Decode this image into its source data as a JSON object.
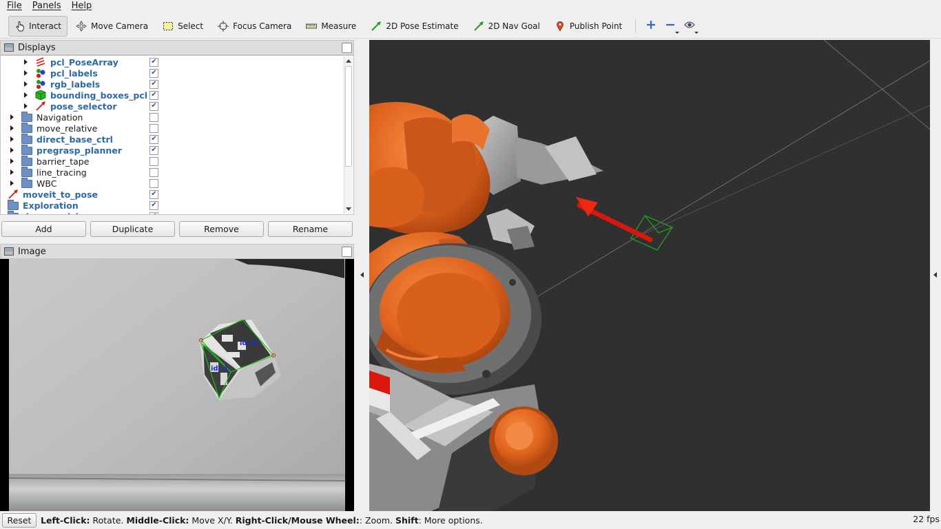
{
  "menubar": {
    "items": [
      {
        "label": "File"
      },
      {
        "label": "Panels"
      },
      {
        "label": "Help"
      }
    ]
  },
  "toolbar": {
    "interact": "Interact",
    "move_camera": "Move Camera",
    "select": "Select",
    "focus_camera": "Focus Camera",
    "measure": "Measure",
    "pose_estimate": "2D Pose Estimate",
    "nav_goal": "2D Nav Goal",
    "publish_point": "Publish Point",
    "add_tool_icon": "plus-icon",
    "remove_tool_icon": "minus-icon",
    "views_icon": "eye-icon"
  },
  "displays": {
    "title": "Displays",
    "rows": [
      {
        "label": "pcl_PoseArray",
        "checked": true
      },
      {
        "label": "pcl_labels",
        "checked": true
      },
      {
        "label": "rgb_labels",
        "checked": true
      },
      {
        "label": "bounding_boxes_pcl",
        "checked": true
      },
      {
        "label": "pose_selector",
        "checked": true
      },
      {
        "label": "Navigation",
        "checked": false
      },
      {
        "label": "move_relative",
        "checked": false
      },
      {
        "label": "direct_base_ctrl",
        "checked": true
      },
      {
        "label": "pregrasp_planner",
        "checked": true
      },
      {
        "label": "barrier_tape",
        "checked": false
      },
      {
        "label": "line_tracing",
        "checked": false
      },
      {
        "label": "WBC",
        "checked": false
      },
      {
        "label": "moveit_to_pose",
        "checked": true
      },
      {
        "label": "Exploration",
        "checked": true
      },
      {
        "label": "drawer_pick",
        "checked": true
      }
    ],
    "buttons": {
      "add": "Add",
      "duplicate": "Duplicate",
      "remove": "Remove",
      "rename": "Rename"
    }
  },
  "image_panel": {
    "title": "Image",
    "marker_labels": [
      "id=0",
      "id=1"
    ]
  },
  "statusbar": {
    "reset": "Reset",
    "hint_1_key": "Left-Click:",
    "hint_1_val": " Rotate. ",
    "hint_2_key": "Middle-Click:",
    "hint_2_val": " Move X/Y. ",
    "hint_3_key": "Right-Click/Mouse Wheel:",
    "hint_3_val": ": Zoom. ",
    "hint_4_key": "Shift",
    "hint_4_val": ": More options.",
    "fps": "22 fps"
  },
  "colors": {
    "robot_orange": "#e0641e",
    "arrow_red": "#d8180c",
    "view_background": "#303030",
    "label_blue": "#2e6aa6"
  }
}
